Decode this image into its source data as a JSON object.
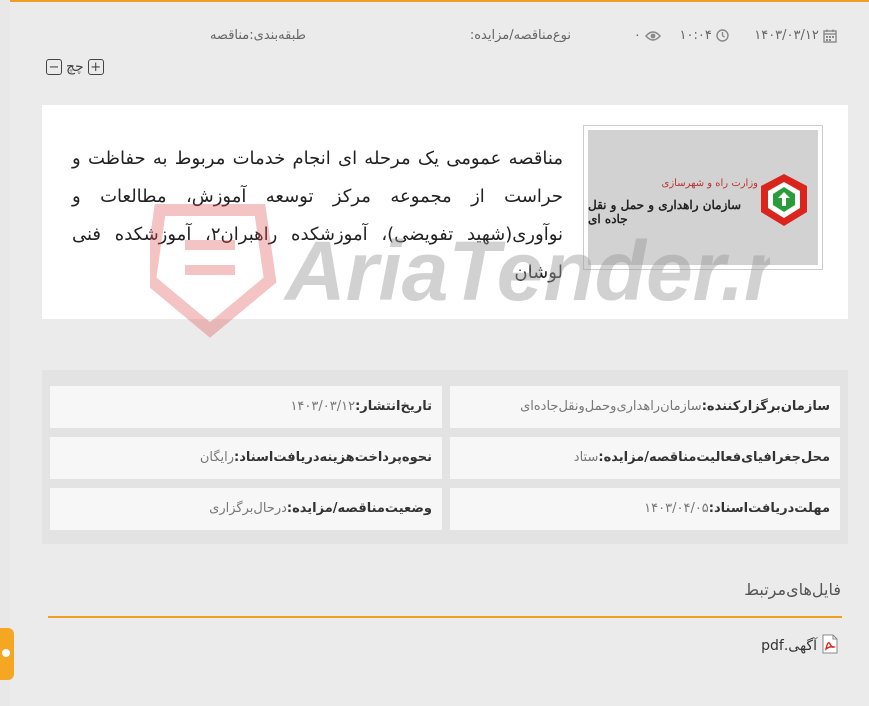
{
  "meta": {
    "date": "۱۴۰۳/۰۳/۱۲",
    "time": "۱۰:۰۴",
    "views": "۰",
    "type_label": "نوع‌مناقصه/مزایده:",
    "category_label": "طبقه‌بندی:مناقصه"
  },
  "zoom": {
    "label": "چچ"
  },
  "tender": {
    "title": "مناقصه عمومی یک مرحله ای انجام خدمات مربوط به حفاظت و حراست از مجموعه مرکز توسعه آموزش، مطالعات و نوآوری(شهید تفویضی)، آموزشکده راهبران۲، آموزشکده فنی لوشان",
    "logo_line1": "وزارت راه و شهرسازی",
    "logo_line2": "سازمان راهداری و حمل و نقل جاده ای"
  },
  "watermark": "AriaTender.neT",
  "details": {
    "organizer_label": "سازمان‌برگزارکننده:",
    "organizer_value": "سازمان‌راهداری‌و‌حمل‌و‌نقل‌جاده‌ای",
    "publish_label": "تاریخ‌انتشار:",
    "publish_value": "۱۴۰۳/۰۳/۱۲",
    "region_label": "محل‌جغرافیای‌فعالیت‌مناقصه/مزایده:",
    "region_value": "ستاد",
    "fee_label": "نحوه‌پرداخت‌هزینه‌دریافت‌اسناد:",
    "fee_value": "رایگان",
    "deadline_label": "مهلت‌دریافت‌اسناد:",
    "deadline_value": "۱۴۰۳/۰۴/۰۵",
    "status_label": "وضعیت‌مناقصه/مزایده:",
    "status_value": "درحال‌برگزاری"
  },
  "files": {
    "title": "فایل‌های‌مرتبط",
    "items": [
      {
        "name": "آگهی.pdf",
        "icon": "pdf-icon"
      }
    ]
  },
  "colors": {
    "accent": "#f0a020",
    "pdf": "#d9251c",
    "logo_red": "#d9251c",
    "logo_green": "#2a9d3a"
  }
}
